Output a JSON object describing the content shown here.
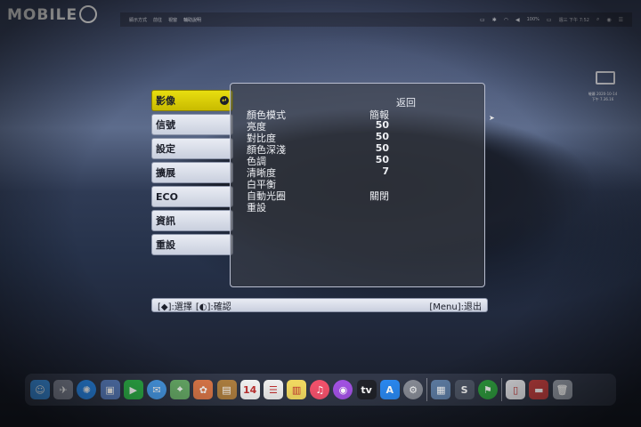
{
  "watermark": {
    "text": "MOBILE"
  },
  "menubar": {
    "menus": [
      "顯示方式",
      "前往",
      "視窗",
      "輔助說明"
    ],
    "battery": "100%",
    "clock": "週三 下午 7:52"
  },
  "desktop_icon": {
    "caption_line1": "螢幕 2020-10-14",
    "caption_line2": "下午 7.36.16"
  },
  "osd": {
    "tabs": [
      {
        "label": "影像",
        "active": true
      },
      {
        "label": "信號",
        "active": false
      },
      {
        "label": "設定",
        "active": false
      },
      {
        "label": "擴展",
        "active": false
      },
      {
        "label": "ECO",
        "active": false
      },
      {
        "label": "資訊",
        "active": false
      },
      {
        "label": "重設",
        "active": false
      }
    ],
    "back_label": "返回",
    "rows": [
      {
        "label": "顏色模式",
        "value": "簡報"
      },
      {
        "label": "亮度",
        "value": "50"
      },
      {
        "label": "對比度",
        "value": "50"
      },
      {
        "label": "顏色深淺",
        "value": "50"
      },
      {
        "label": "色調",
        "value": "50"
      },
      {
        "label": "清晰度",
        "value": "7"
      },
      {
        "label": "白平衡",
        "value": ""
      },
      {
        "label": "自動光圈",
        "value": "關閉"
      },
      {
        "label": "重設",
        "value": ""
      }
    ],
    "hint_select": "[◆]:選擇",
    "hint_confirm": "[◐]:確認",
    "hint_exit": "[Menu]:退出"
  },
  "dock": {
    "icons": [
      {
        "name": "finder-icon",
        "glyph": "☺",
        "color": "#3b8fe0"
      },
      {
        "name": "launchpad-icon",
        "glyph": "✈",
        "color": "#7b8090"
      },
      {
        "name": "safari-icon",
        "glyph": "✺",
        "color": "#2a88e8"
      },
      {
        "name": "preview-icon",
        "glyph": "▣",
        "color": "#5a7fc0"
      },
      {
        "name": "facetime-icon",
        "glyph": "▶",
        "color": "#2fb44a"
      },
      {
        "name": "messages-icon",
        "glyph": "✉",
        "color": "#4aa0f0"
      },
      {
        "name": "maps-icon",
        "glyph": "⌖",
        "color": "#6ab06a"
      },
      {
        "name": "photos-icon",
        "glyph": "✿",
        "color": "#e07a4a"
      },
      {
        "name": "notes-brown-icon",
        "glyph": "▤",
        "color": "#b08040"
      },
      {
        "name": "calendar-icon",
        "glyph": "14",
        "color": "#f4f4f4"
      },
      {
        "name": "reminders-icon",
        "glyph": "☰",
        "color": "#eeeeee"
      },
      {
        "name": "notes-icon",
        "glyph": "▥",
        "color": "#f0d860"
      },
      {
        "name": "music-icon",
        "glyph": "♫",
        "color": "#f0506a"
      },
      {
        "name": "podcasts-icon",
        "glyph": "◉",
        "color": "#a050e0"
      },
      {
        "name": "tv-icon",
        "glyph": "tv",
        "color": "#202228"
      },
      {
        "name": "app-store-icon",
        "glyph": "A",
        "color": "#2a88f0"
      },
      {
        "name": "system-preferences-icon",
        "glyph": "⚙",
        "color": "#8a8e98"
      },
      {
        "name": "photo-viewer-icon",
        "glyph": "▦",
        "color": "#6080a8"
      },
      {
        "name": "s-app-icon",
        "glyph": "S",
        "color": "#505868"
      },
      {
        "name": "green-app-icon",
        "glyph": "⚑",
        "color": "#30a040"
      },
      {
        "name": "document-icon",
        "glyph": "▯",
        "color": "#e8e8ec"
      },
      {
        "name": "screenshot-icon",
        "glyph": "▬",
        "color": "#c04040"
      },
      {
        "name": "trash-icon",
        "glyph": "🗑",
        "color": "#9aa0ac"
      }
    ]
  }
}
